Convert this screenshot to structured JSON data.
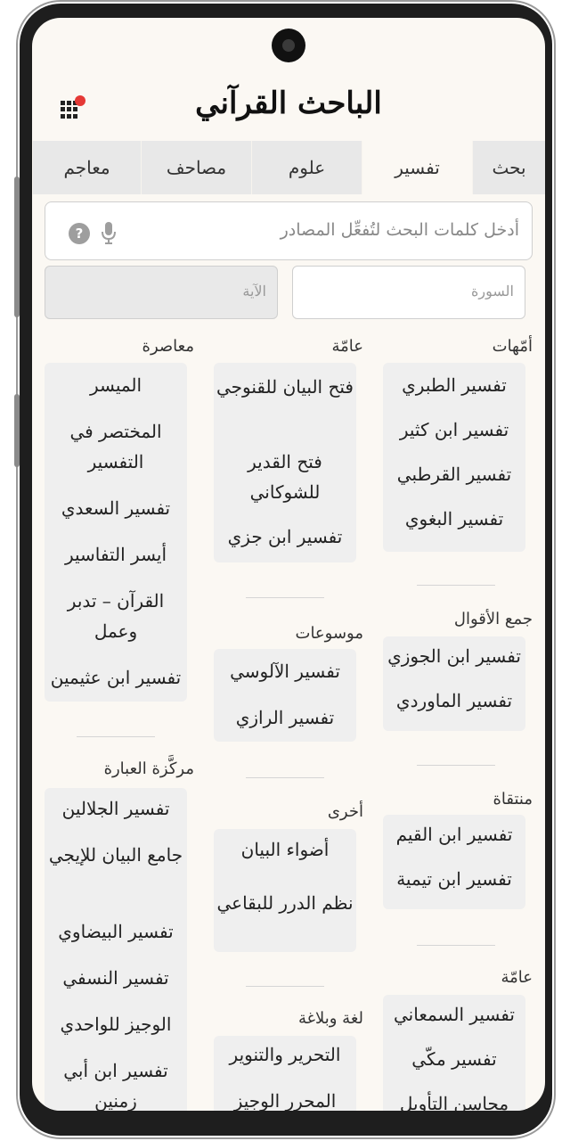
{
  "app": {
    "title": "الباحث القرآني"
  },
  "tabs": [
    {
      "label": "بحث",
      "active": false
    },
    {
      "label": "تفسير",
      "active": true
    },
    {
      "label": "علوم",
      "active": false
    },
    {
      "label": "مصاحف",
      "active": false
    },
    {
      "label": "معاجم",
      "active": false
    }
  ],
  "search": {
    "placeholder": "أدخل كلمات البحث لتُفعِّل المصادر"
  },
  "fields": {
    "surah_placeholder": "السورة",
    "ayah_placeholder": "الآية"
  },
  "icons": {
    "menu": "grid-menu-icon",
    "notification": "red-dot",
    "mic": "microphone-icon",
    "help": "help-circle-icon"
  },
  "colors": {
    "background": "#fbf8f3",
    "card": "#efefef",
    "notification": "#e53935",
    "tab_bar": "#e8e8e8"
  },
  "groups": {
    "ummahat": {
      "heading": "أمّهات",
      "items": [
        "تفسير الطبري",
        "تفسير ابن كثير",
        "تفسير القرطبي",
        "تفسير البغوي"
      ]
    },
    "amma1": {
      "heading": "عامّة",
      "items": [
        "فتح البيان للقنوجي",
        "فتح القدير للشوكاني",
        "تفسير ابن جزي"
      ]
    },
    "muasira": {
      "heading": "معاصرة",
      "items": [
        "الميسر",
        "المختصر في التفسير",
        "تفسير السعدي",
        "أيسر التفاسير",
        "القرآن – تدبر وعمل",
        "تفسير ابن عثيمين"
      ]
    },
    "jam_aqwal": {
      "heading": "جمع الأقوال",
      "items": [
        "تفسير ابن الجوزي",
        "تفسير الماوردي"
      ]
    },
    "mawsuat": {
      "heading": "موسوعات",
      "items": [
        "تفسير الآلوسي",
        "تفسير الرازي"
      ]
    },
    "muntaqa": {
      "heading": "منتقاة",
      "items": [
        "تفسير ابن القيم",
        "تفسير ابن تيمية"
      ]
    },
    "ukhra": {
      "heading": "أخرى",
      "items": [
        "أضواء البيان",
        "نظم الدرر للبقاعي"
      ]
    },
    "murakkaza": {
      "heading": "مركَّزة العبارة",
      "items": [
        "تفسير الجلالين",
        "جامع البيان للإيجي",
        "تفسير البيضاوي",
        "تفسير النسفي",
        "الوجيز للواحدي",
        "تفسير ابن أبي زمنين"
      ]
    },
    "amma2": {
      "heading": "عامّة",
      "items": [
        "تفسير السمعاني",
        "تفسير مكّي",
        "محاسن التأويل"
      ]
    },
    "lugha": {
      "heading": "لغة وبلاغة",
      "items": [
        "التحرير والتنوير",
        "المحرر الوجيز"
      ]
    }
  }
}
